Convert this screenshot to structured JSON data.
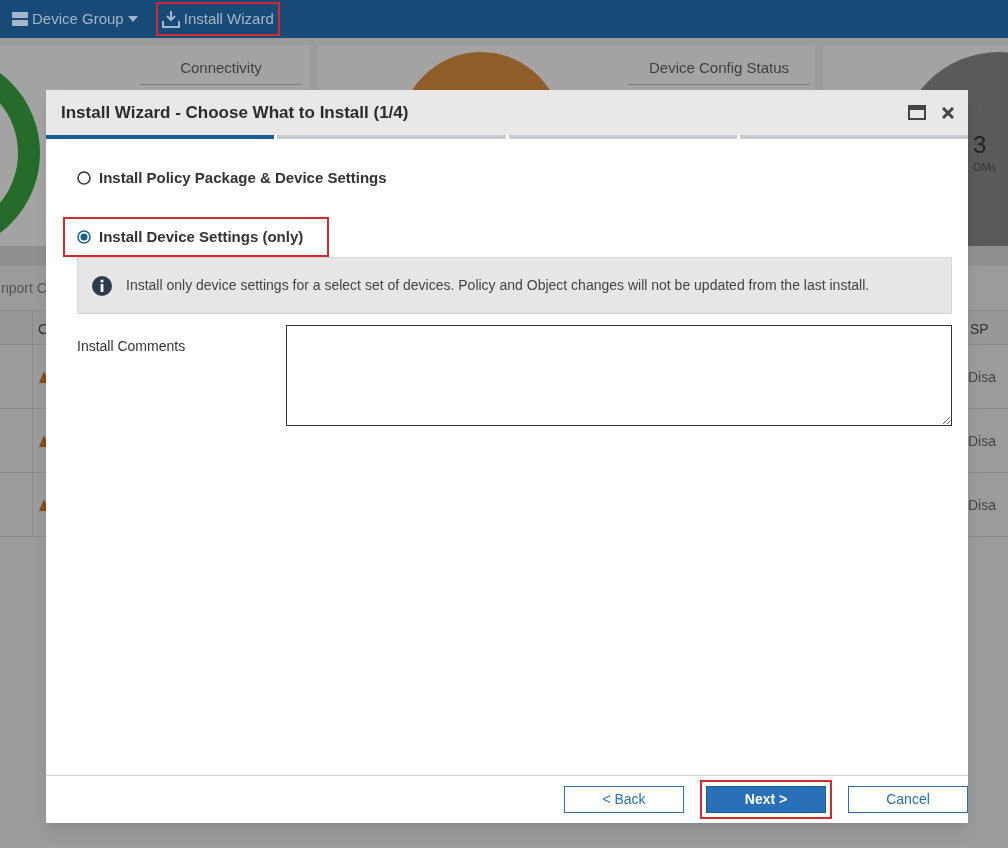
{
  "top_bar": {
    "items": [
      {
        "kind": "menu",
        "label": "Device Group",
        "highlighted": false
      },
      {
        "kind": "button",
        "label": "Install Wizard",
        "highlighted": true
      }
    ]
  },
  "dashboard": {
    "cards": [
      {
        "kind": "ring",
        "title": "Connectivity"
      },
      {
        "kind": "disc",
        "title": "Device Config Status"
      },
      {
        "kind": "count",
        "value": "3",
        "caption": "OMs"
      }
    ]
  },
  "toolbar": {
    "button": "nport C"
  },
  "table": {
    "columns": [
      "C",
      "SP"
    ],
    "rows": [
      {
        "warning": true,
        "column_last": "Disa"
      },
      {
        "warning": true,
        "column_last": "Disa"
      },
      {
        "warning": true,
        "column_last": "Disa"
      }
    ]
  },
  "dialog": {
    "title": "Install Wizard - Choose What to Install (1/4)",
    "steps": [
      {
        "selected": true
      },
      {
        "selected": false
      },
      {
        "selected": false
      },
      {
        "selected": false
      }
    ],
    "options": [
      {
        "label": "Install Policy Package & Device Settings",
        "selected": false,
        "highlighted": false
      },
      {
        "label": "Install Device Settings (only)",
        "selected": true,
        "highlighted": true
      }
    ],
    "info": "Install only device settings for a select set of devices. Policy and Object changes will not be updated from the last install.",
    "comments_label": "Install Comments",
    "buttons": [
      {
        "kind": "secondary",
        "label": "< Back",
        "highlighted": false
      },
      {
        "kind": "primary",
        "label": "Next >",
        "highlighted": true
      },
      {
        "kind": "secondary",
        "label": "Cancel",
        "highlighted": false
      }
    ]
  }
}
